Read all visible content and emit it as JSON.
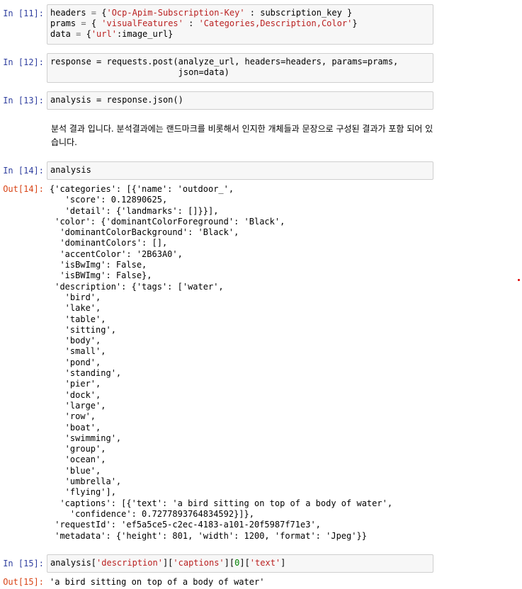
{
  "cells": {
    "c11": {
      "prompt": "In [11]:",
      "lines": [
        [
          "headers ",
          "=",
          " {",
          "'Ocp-Apim-Subscription-Key'",
          " : subscription_key }"
        ],
        [
          "prams ",
          "=",
          " { ",
          "'visualFeatures'",
          " : ",
          "'Categories,Description,Color'",
          "}"
        ],
        [
          "data ",
          "=",
          " {",
          "'url'",
          ":image_url}"
        ]
      ]
    },
    "c12": {
      "prompt": "In [12]:",
      "line1": "response = requests.post(analyze_url, headers=headers, params=prams,",
      "line2": "                         json=data)"
    },
    "c13": {
      "prompt": "In [13]:",
      "code": "analysis = response.json()"
    },
    "markdown": {
      "text": "분석 결과 입니다. 분석결과에는 랜드마크를 비롯해서 인지한 개체들과 문장으로 구성된 결과가 포함 되어 있습니다."
    },
    "c14": {
      "prompt": "In [14]:",
      "code": "analysis",
      "out_prompt": "Out[14]:",
      "output": "{'categories': [{'name': 'outdoor_',\n   'score': 0.12890625,\n   'detail': {'landmarks': []}}],\n 'color': {'dominantColorForeground': 'Black',\n  'dominantColorBackground': 'Black',\n  'dominantColors': [],\n  'accentColor': '2B63A0',\n  'isBwImg': False,\n  'isBWImg': False},\n 'description': {'tags': ['water',\n   'bird',\n   'lake',\n   'table',\n   'sitting',\n   'body',\n   'small',\n   'pond',\n   'standing',\n   'pier',\n   'dock',\n   'large',\n   'row',\n   'boat',\n   'swimming',\n   'group',\n   'ocean',\n   'blue',\n   'umbrella',\n   'flying'],\n  'captions': [{'text': 'a bird sitting on top of a body of water',\n    'confidence': 0.7277893764834592}]},\n 'requestId': 'ef5a5ce5-c2ec-4183-a101-20f5987f71e3',\n 'metadata': {'height': 801, 'width': 1200, 'format': 'Jpeg'}}"
    },
    "c15": {
      "prompt": "In [15]:",
      "code_parts": [
        "analysis[",
        "'description'",
        "][",
        "'captions'",
        "][",
        "0",
        "][",
        "'text'",
        "]"
      ],
      "out_prompt": "Out[15]:",
      "output": "'a bird sitting on top of a body of water'"
    }
  }
}
